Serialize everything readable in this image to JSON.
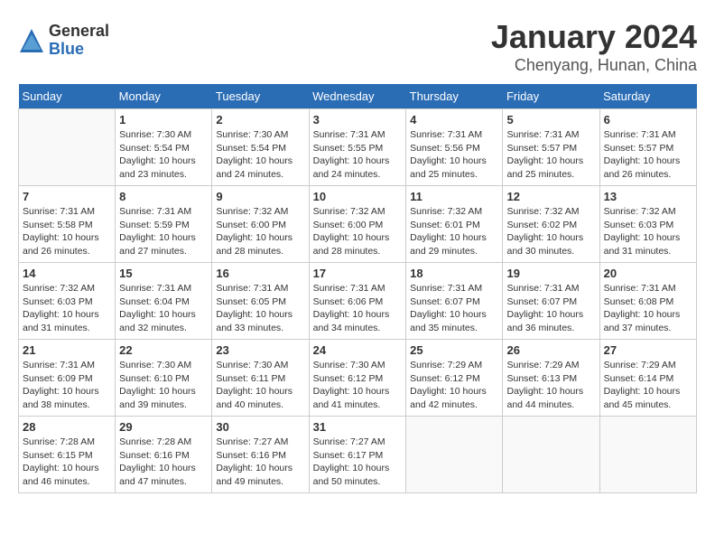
{
  "logo": {
    "general": "General",
    "blue": "Blue"
  },
  "header": {
    "month": "January 2024",
    "location": "Chenyang, Hunan, China"
  },
  "weekdays": [
    "Sunday",
    "Monday",
    "Tuesday",
    "Wednesday",
    "Thursday",
    "Friday",
    "Saturday"
  ],
  "weeks": [
    [
      {
        "day": "",
        "sunrise": "",
        "sunset": "",
        "daylight": ""
      },
      {
        "day": "1",
        "sunrise": "Sunrise: 7:30 AM",
        "sunset": "Sunset: 5:54 PM",
        "daylight": "Daylight: 10 hours and 23 minutes."
      },
      {
        "day": "2",
        "sunrise": "Sunrise: 7:30 AM",
        "sunset": "Sunset: 5:54 PM",
        "daylight": "Daylight: 10 hours and 24 minutes."
      },
      {
        "day": "3",
        "sunrise": "Sunrise: 7:31 AM",
        "sunset": "Sunset: 5:55 PM",
        "daylight": "Daylight: 10 hours and 24 minutes."
      },
      {
        "day": "4",
        "sunrise": "Sunrise: 7:31 AM",
        "sunset": "Sunset: 5:56 PM",
        "daylight": "Daylight: 10 hours and 25 minutes."
      },
      {
        "day": "5",
        "sunrise": "Sunrise: 7:31 AM",
        "sunset": "Sunset: 5:57 PM",
        "daylight": "Daylight: 10 hours and 25 minutes."
      },
      {
        "day": "6",
        "sunrise": "Sunrise: 7:31 AM",
        "sunset": "Sunset: 5:57 PM",
        "daylight": "Daylight: 10 hours and 26 minutes."
      }
    ],
    [
      {
        "day": "7",
        "sunrise": "Sunrise: 7:31 AM",
        "sunset": "Sunset: 5:58 PM",
        "daylight": "Daylight: 10 hours and 26 minutes."
      },
      {
        "day": "8",
        "sunrise": "Sunrise: 7:31 AM",
        "sunset": "Sunset: 5:59 PM",
        "daylight": "Daylight: 10 hours and 27 minutes."
      },
      {
        "day": "9",
        "sunrise": "Sunrise: 7:32 AM",
        "sunset": "Sunset: 6:00 PM",
        "daylight": "Daylight: 10 hours and 28 minutes."
      },
      {
        "day": "10",
        "sunrise": "Sunrise: 7:32 AM",
        "sunset": "Sunset: 6:00 PM",
        "daylight": "Daylight: 10 hours and 28 minutes."
      },
      {
        "day": "11",
        "sunrise": "Sunrise: 7:32 AM",
        "sunset": "Sunset: 6:01 PM",
        "daylight": "Daylight: 10 hours and 29 minutes."
      },
      {
        "day": "12",
        "sunrise": "Sunrise: 7:32 AM",
        "sunset": "Sunset: 6:02 PM",
        "daylight": "Daylight: 10 hours and 30 minutes."
      },
      {
        "day": "13",
        "sunrise": "Sunrise: 7:32 AM",
        "sunset": "Sunset: 6:03 PM",
        "daylight": "Daylight: 10 hours and 31 minutes."
      }
    ],
    [
      {
        "day": "14",
        "sunrise": "Sunrise: 7:32 AM",
        "sunset": "Sunset: 6:03 PM",
        "daylight": "Daylight: 10 hours and 31 minutes."
      },
      {
        "day": "15",
        "sunrise": "Sunrise: 7:31 AM",
        "sunset": "Sunset: 6:04 PM",
        "daylight": "Daylight: 10 hours and 32 minutes."
      },
      {
        "day": "16",
        "sunrise": "Sunrise: 7:31 AM",
        "sunset": "Sunset: 6:05 PM",
        "daylight": "Daylight: 10 hours and 33 minutes."
      },
      {
        "day": "17",
        "sunrise": "Sunrise: 7:31 AM",
        "sunset": "Sunset: 6:06 PM",
        "daylight": "Daylight: 10 hours and 34 minutes."
      },
      {
        "day": "18",
        "sunrise": "Sunrise: 7:31 AM",
        "sunset": "Sunset: 6:07 PM",
        "daylight": "Daylight: 10 hours and 35 minutes."
      },
      {
        "day": "19",
        "sunrise": "Sunrise: 7:31 AM",
        "sunset": "Sunset: 6:07 PM",
        "daylight": "Daylight: 10 hours and 36 minutes."
      },
      {
        "day": "20",
        "sunrise": "Sunrise: 7:31 AM",
        "sunset": "Sunset: 6:08 PM",
        "daylight": "Daylight: 10 hours and 37 minutes."
      }
    ],
    [
      {
        "day": "21",
        "sunrise": "Sunrise: 7:31 AM",
        "sunset": "Sunset: 6:09 PM",
        "daylight": "Daylight: 10 hours and 38 minutes."
      },
      {
        "day": "22",
        "sunrise": "Sunrise: 7:30 AM",
        "sunset": "Sunset: 6:10 PM",
        "daylight": "Daylight: 10 hours and 39 minutes."
      },
      {
        "day": "23",
        "sunrise": "Sunrise: 7:30 AM",
        "sunset": "Sunset: 6:11 PM",
        "daylight": "Daylight: 10 hours and 40 minutes."
      },
      {
        "day": "24",
        "sunrise": "Sunrise: 7:30 AM",
        "sunset": "Sunset: 6:12 PM",
        "daylight": "Daylight: 10 hours and 41 minutes."
      },
      {
        "day": "25",
        "sunrise": "Sunrise: 7:29 AM",
        "sunset": "Sunset: 6:12 PM",
        "daylight": "Daylight: 10 hours and 42 minutes."
      },
      {
        "day": "26",
        "sunrise": "Sunrise: 7:29 AM",
        "sunset": "Sunset: 6:13 PM",
        "daylight": "Daylight: 10 hours and 44 minutes."
      },
      {
        "day": "27",
        "sunrise": "Sunrise: 7:29 AM",
        "sunset": "Sunset: 6:14 PM",
        "daylight": "Daylight: 10 hours and 45 minutes."
      }
    ],
    [
      {
        "day": "28",
        "sunrise": "Sunrise: 7:28 AM",
        "sunset": "Sunset: 6:15 PM",
        "daylight": "Daylight: 10 hours and 46 minutes."
      },
      {
        "day": "29",
        "sunrise": "Sunrise: 7:28 AM",
        "sunset": "Sunset: 6:16 PM",
        "daylight": "Daylight: 10 hours and 47 minutes."
      },
      {
        "day": "30",
        "sunrise": "Sunrise: 7:27 AM",
        "sunset": "Sunset: 6:16 PM",
        "daylight": "Daylight: 10 hours and 49 minutes."
      },
      {
        "day": "31",
        "sunrise": "Sunrise: 7:27 AM",
        "sunset": "Sunset: 6:17 PM",
        "daylight": "Daylight: 10 hours and 50 minutes."
      },
      {
        "day": "",
        "sunrise": "",
        "sunset": "",
        "daylight": ""
      },
      {
        "day": "",
        "sunrise": "",
        "sunset": "",
        "daylight": ""
      },
      {
        "day": "",
        "sunrise": "",
        "sunset": "",
        "daylight": ""
      }
    ]
  ]
}
